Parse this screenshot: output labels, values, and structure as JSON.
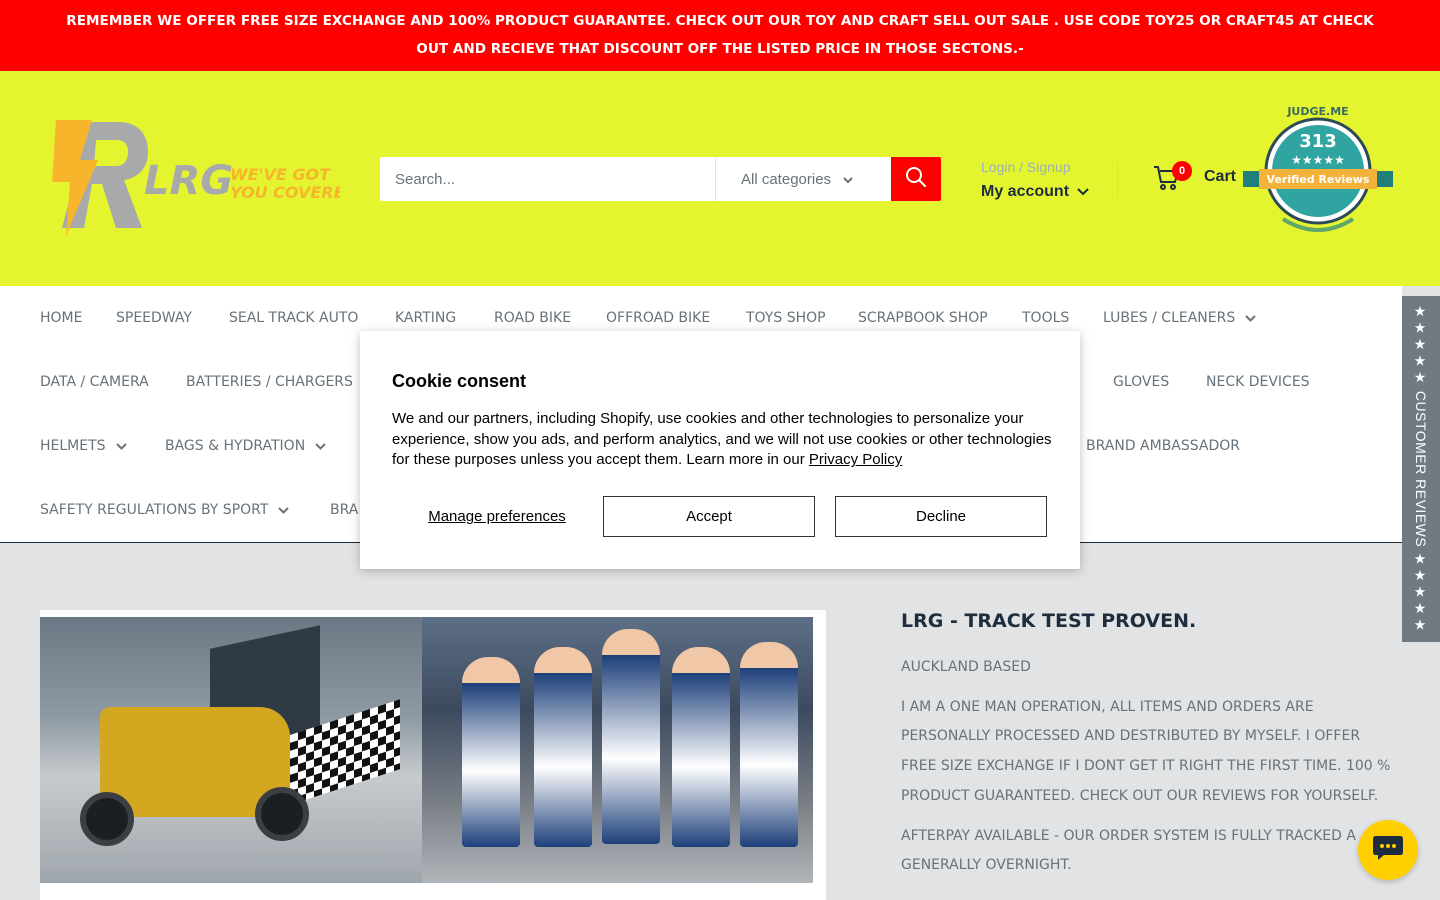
{
  "announcement": {
    "text": "REMEMBER WE OFFER FREE SIZE EXCHANGE AND 100% PRODUCT GUARANTEE. CHECK OUT OUR TOY AND CRAFT SELL OUT SALE . USE CODE TOY25 OR CRAFT45 AT CHECK OUT AND RECIEVE THAT DISCOUNT OFF THE LISTED PRICE IN THOSE SECTONS.-"
  },
  "logo": {
    "brand": "LRG",
    "tagline_1": "WE'VE GOT",
    "tagline_2": "YOU COVERED"
  },
  "search": {
    "placeholder": "Search...",
    "category": "All categories"
  },
  "account": {
    "login": "Login / Signup",
    "my_account": "My account"
  },
  "cart": {
    "count": "0",
    "label": "Cart"
  },
  "badge": {
    "top": "JUDGE.ME",
    "count": "313",
    "stars": "★★★★★",
    "label": "Verified Reviews"
  },
  "nav": {
    "items": [
      {
        "label": "HOME"
      },
      {
        "label": "SPEEDWAY"
      },
      {
        "label": "SEAL TRACK AUTO"
      },
      {
        "label": "KARTING"
      },
      {
        "label": "ROAD BIKE"
      },
      {
        "label": "OFFROAD BIKE"
      },
      {
        "label": "TOYS SHOP"
      },
      {
        "label": "SCRAPBOOK SHOP"
      },
      {
        "label": "TOOLS"
      },
      {
        "label": "LUBES / CLEANERS"
      },
      {
        "label": "DATA / CAMERA"
      },
      {
        "label": "BATTERIES / CHARGERS"
      },
      {
        "label": "GLOVES"
      },
      {
        "label": "NECK DEVICES"
      },
      {
        "label": "HELMETS"
      },
      {
        "label": "BAGS & HYDRATION"
      },
      {
        "label": "BRAND AMBASSADOR"
      },
      {
        "label": "SAFETY REGULATIONS BY SPORT"
      },
      {
        "label": "BRA"
      }
    ]
  },
  "side_tab": {
    "label": "★★★★★ CUSTOMER REVIEWS ★★★★★"
  },
  "info": {
    "title": "LRG - TRACK TEST PROVEN.",
    "location": "AUCKLAND BASED",
    "about": "I AM A ONE MAN OPERATION, ALL ITEMS AND ORDERS ARE PERSONALLY PROCESSED AND DESTRIBUTED BY MYSELF. I OFFER FREE SIZE EXCHANGE IF I DONT GET IT RIGHT THE FIRST TIME. 100 % PRODUCT GUARANTEED. CHECK OUT OUR REVIEWS FOR YOURSELF.",
    "afterpay": "AFTERPAY AVAILABLE - OUR ORDER SYSTEM IS FULLY TRACKED A GENERALLY OVERNIGHT."
  },
  "cookie": {
    "title": "Cookie consent",
    "text": "We and our partners, including Shopify, use cookies and other technologies to personalize your experience, show you ads, and perform analytics, and we will not use cookies or other technologies for these purposes unless you accept them. Learn more in our ",
    "link": "Privacy Policy",
    "manage": "Manage preferences",
    "accept": "Accept",
    "decline": "Decline"
  },
  "colors": {
    "announcement_bg": "#fe0000",
    "header_bg": "#e4f530",
    "accent": "#fe0000",
    "heading": "#1e2d3d",
    "text_muted": "#677279",
    "chat_bg": "#ffcf00"
  },
  "icons": [
    "search-icon",
    "cart-icon",
    "chevron-down-icon",
    "chat-icon"
  ]
}
